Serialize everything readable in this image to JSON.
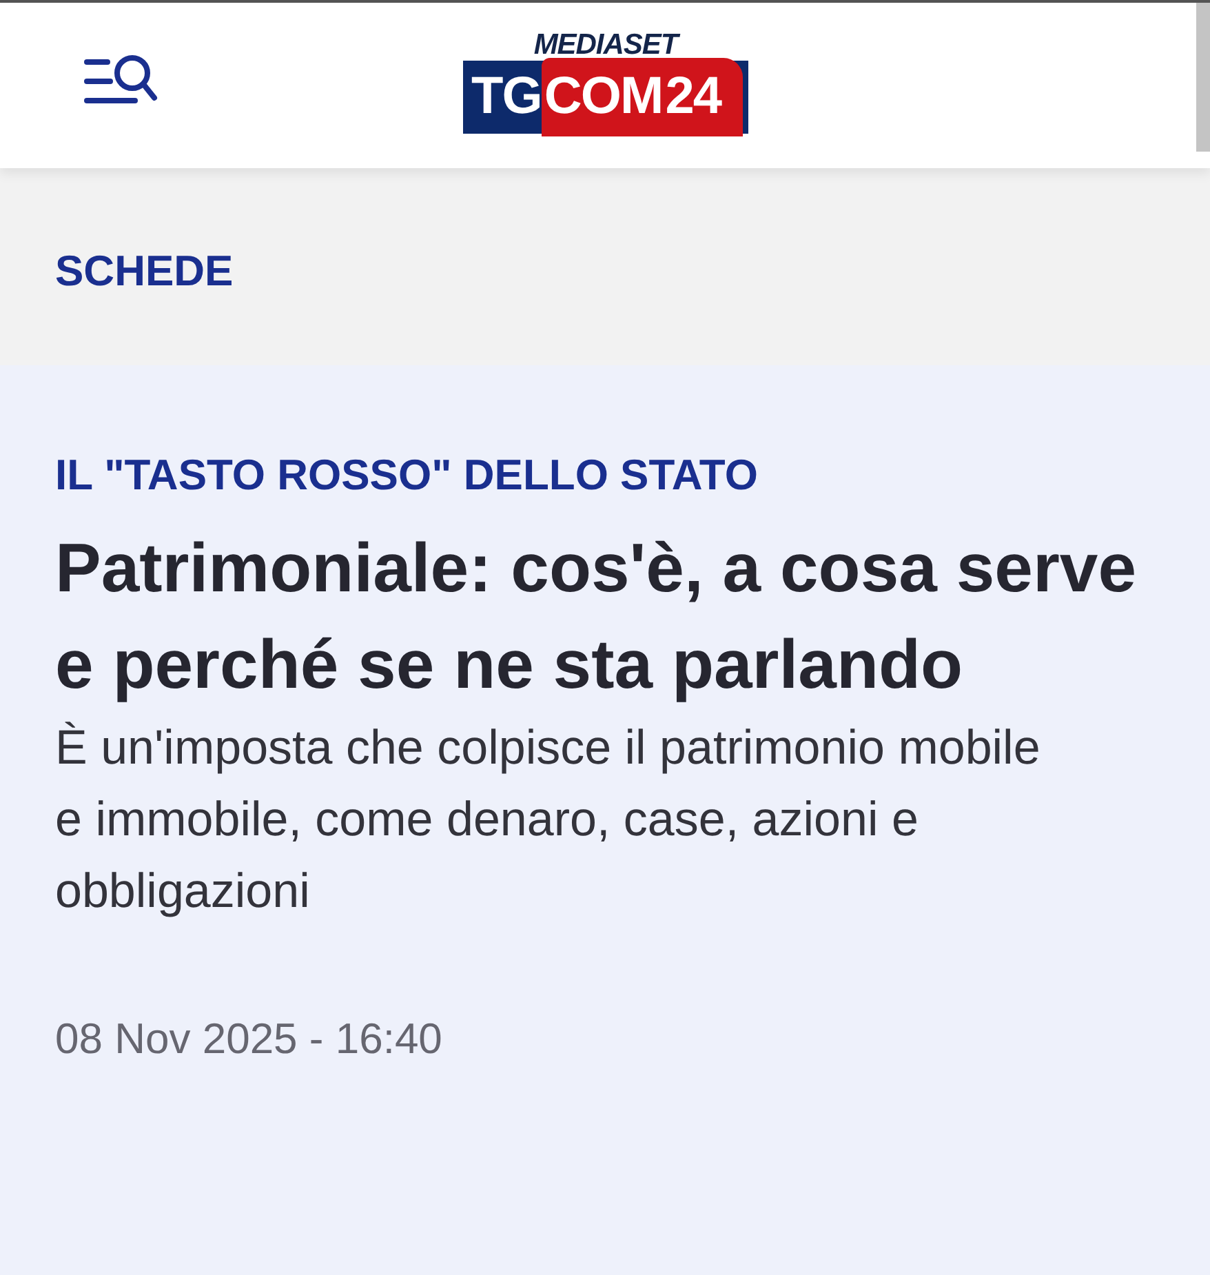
{
  "header": {
    "logo": {
      "top": "MEDIASET",
      "part_1": "TG",
      "part_2": "COM",
      "part_3": "24"
    }
  },
  "section": {
    "title": "SCHEDE"
  },
  "article": {
    "kicker": "IL \"TASTO ROSSO\" DELLO STATO",
    "title": "Patrimoniale: cos'è, a cosa serve e perché se ne sta parlando",
    "summary": "È un'imposta che colpisce il patrimonio mobile e immobile, come denaro, case, azioni e obbligazioni",
    "date": "08 Nov 2025 - 16:40"
  }
}
